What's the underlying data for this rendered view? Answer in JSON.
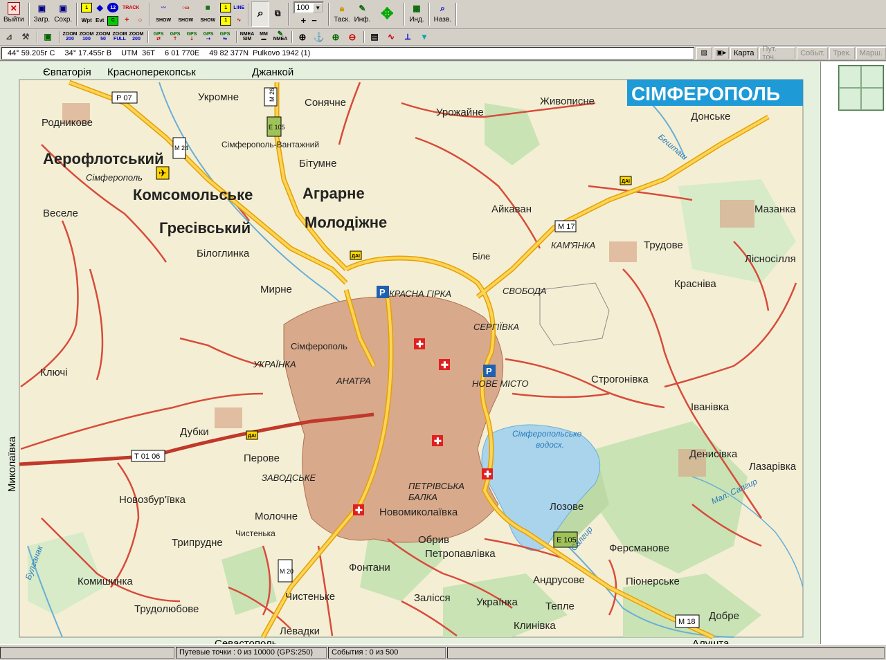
{
  "toolbar1": {
    "exit": "Выйти",
    "load": "Загр.",
    "save": "Сохр.",
    "wpt": "Wpt",
    "evt": "Evt",
    "track": "TRACK",
    "show1": "SHOW",
    "show2": "SHOW",
    "show3": "SHOW",
    "line": "LINE",
    "zoom_value": "100",
    "task": "Таск.",
    "info": "Инф.",
    "ind": "Инд.",
    "names": "Назв."
  },
  "toolbar2": {
    "zoom_buttons": [
      {
        "top": "ZOOM",
        "bottom": "200"
      },
      {
        "top": "ZOOM",
        "bottom": "100"
      },
      {
        "top": "ZOOM",
        "bottom": "50"
      },
      {
        "top": "ZOOM",
        "bottom": "FULL"
      },
      {
        "top": "ZOOM",
        "bottom": "200"
      }
    ],
    "gps_label": "GPS",
    "nmea_label": "NMEA",
    "sim_label": "SIM",
    "mm_label": "MM"
  },
  "coordbar": {
    "lat": "44° 59.205г С",
    "lon": "34° 17.455г В",
    "utm_label": "UTM",
    "utm_zone": "36T",
    "easting": "6 01 770E",
    "northing": "49 82 377N",
    "datum": "Pulkovo 1942 (1)",
    "tabs": [
      "Карта",
      "Пут. точ.",
      "Событ.",
      "Трек.",
      "Марш."
    ]
  },
  "map": {
    "city_title": "СІМФЕРОПОЛЬ",
    "directions": [
      "Євпаторія",
      "Красноперекопськ",
      "Джанкой",
      "Миколаївка",
      "Севастополь",
      "Алушта"
    ],
    "large_labels": [
      "Аерофлотський",
      "Комсомольське",
      "Гресівський",
      "Аграрне",
      "Молодіжне"
    ],
    "places": [
      "Родникове",
      "Укромне",
      "Сонячне",
      "Урожайне",
      "Живописне",
      "Донське",
      "Сімферополь-Вантажний",
      "Бітумне",
      "Сімферополь",
      "Веселе",
      "Білоглинка",
      "Айкаван",
      "Мазанка",
      "Трудове",
      "Лісносілля",
      "Красніва",
      "Біле",
      "КАМ'ЯНКА",
      "СВОБОДА",
      "КРАСНА ГІРКА",
      "СЕРГІЇВКА",
      "Мирне",
      "УКРАЇНКА",
      "Сімферополь",
      "Ключі",
      "АНАТРА",
      "НОВЕ МІСТО",
      "Строгонівка",
      "Іванівка",
      "Дубки",
      "Перове",
      "ЗАВОДСЬКЕ",
      "Денисівка",
      "Лазарівка",
      "Новозбур'ївка",
      "ПЕТРІВСЬКА",
      "БАЛКА",
      "Новомиколаївка",
      "Лозове",
      "Молочне",
      "Чистенька",
      "Трипрудне",
      "Обрив",
      "Петропавлівка",
      "Ферсманове",
      "Комишинка",
      "Фонтани",
      "Андрусове",
      "Піонерське",
      "Трудолюбове",
      "Чистеньке",
      "Залісся",
      "Українка",
      "Тепле",
      "Добре",
      "Левадки",
      "Клинівка"
    ],
    "water_labels": [
      "Сімферопольське",
      "водосх.",
      "Мал. Салгир",
      "Салгир",
      "Бешташ",
      "Булганак"
    ],
    "roads": [
      "Р 07",
      "М 24",
      "М 26",
      "Е 105",
      "М 17",
      "Т 01 06",
      "М 20",
      "Е 105",
      "М 18"
    ],
    "other_labels": [
      "Сімферополь",
      "ДАІ"
    ]
  },
  "status": {
    "waypoints": "Путевые точки : 0 из 10000  (GPS:250)",
    "events": "События : 0 из 500"
  }
}
